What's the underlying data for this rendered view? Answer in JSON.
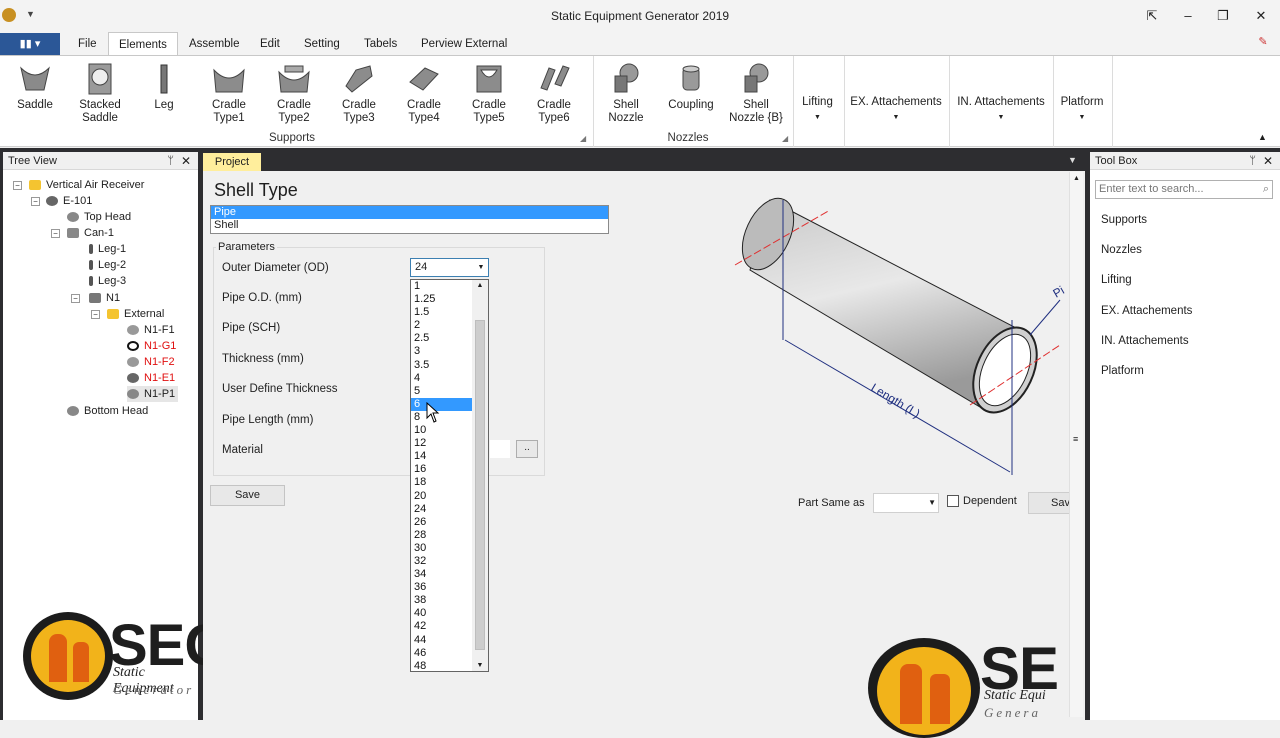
{
  "window": {
    "title": "Static Equipment Generator 2019"
  },
  "menu": {
    "tabs": [
      "File",
      "Elements",
      "Assemble",
      "Edit",
      "Setting",
      "Tabels",
      "Perview External"
    ],
    "active": "Elements"
  },
  "ribbon": {
    "buttons": [
      "Saddle",
      "Stacked\nSaddle",
      "Leg",
      "Cradle\nType1",
      "Cradle\nType2",
      "Cradle\nType3",
      "Cradle\nType4",
      "Cradle\nType5",
      "Cradle\nType6",
      "Shell\nNozzle",
      "Coupling",
      "Shell\nNozzle {B}",
      "Lifting",
      "EX. Attachements",
      "IN. Attachements",
      "Platform"
    ],
    "groups": {
      "supports": "Supports",
      "nozzles": "Nozzles"
    }
  },
  "tree_view": {
    "title": "Tree View",
    "nodes": [
      {
        "label": "Vertical Air Receiver",
        "color": "#1e1e1e"
      },
      {
        "label": "E-101",
        "color": "#1e1e1e"
      },
      {
        "label": "Top Head",
        "color": "#1e1e1e"
      },
      {
        "label": "Can-1",
        "color": "#1e1e1e"
      },
      {
        "label": "Leg-1",
        "color": "#1e1e1e"
      },
      {
        "label": "Leg-2",
        "color": "#1e1e1e"
      },
      {
        "label": "Leg-3",
        "color": "#1e1e1e"
      },
      {
        "label": "N1",
        "color": "#1e1e1e"
      },
      {
        "label": "External",
        "color": "#1e1e1e"
      },
      {
        "label": "N1-F1",
        "color": "#1e1e1e"
      },
      {
        "label": "N1-G1",
        "color": "#e01010"
      },
      {
        "label": "N1-F2",
        "color": "#e01010"
      },
      {
        "label": "N1-E1",
        "color": "#e01010"
      },
      {
        "label": "N1-P1",
        "color": "#1e1e1e"
      },
      {
        "label": "Bottom Head",
        "color": "#1e1e1e"
      }
    ]
  },
  "project": {
    "tab": "Project",
    "heading": "Shell Type",
    "shell_types": [
      "Pipe",
      "Shell"
    ],
    "shell_selected": "Pipe",
    "params_legend": "Parameters",
    "params": [
      "Outer Diameter (OD)",
      "Pipe O.D. (mm)",
      "Pipe (SCH)",
      "Thickness (mm)",
      "User Define Thickness",
      "Pipe Length (mm)",
      "Material"
    ],
    "od_value": "24",
    "od_options": [
      "1",
      "1.25",
      "1.5",
      "2",
      "2.5",
      "3",
      "3.5",
      "4",
      "5",
      "6",
      "8",
      "10",
      "12",
      "14",
      "16",
      "18",
      "20",
      "24",
      "26",
      "28",
      "30",
      "32",
      "34",
      "36",
      "38",
      "40",
      "42",
      "44",
      "46",
      "48"
    ],
    "od_highlight": "6",
    "material_button": "..",
    "save": "Save",
    "part_same_as": "Part Same as",
    "dependent": "Dependent",
    "save2": "Save",
    "drawing_label": "Length (L)",
    "drawing_label2": "Pi"
  },
  "toolbox": {
    "title": "Tool Box",
    "search_placeholder": "Enter text to search...",
    "items": [
      "Supports",
      "Nozzles",
      "Lifting",
      "EX. Attachements",
      "IN. Attachements",
      "Platform"
    ]
  },
  "logo": {
    "brand": "SEG",
    "brand_partial": "SE",
    "tagline1": "Static Equipment",
    "tagline2": "Generator",
    "tagline1_partial": "Static Equi",
    "tagline2_partial": "Genera"
  },
  "colors": {
    "accent": "#3399ff",
    "appmenu": "#2b5797",
    "doc_tab": "#ffee9c",
    "warn_text": "#e01010"
  }
}
